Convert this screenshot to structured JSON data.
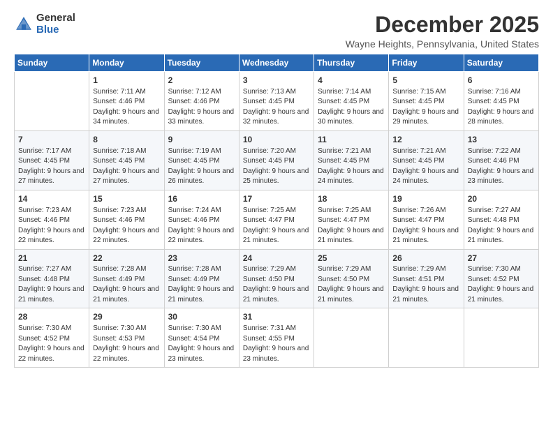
{
  "header": {
    "logo_general": "General",
    "logo_blue": "Blue",
    "month": "December 2025",
    "location": "Wayne Heights, Pennsylvania, United States"
  },
  "days_of_week": [
    "Sunday",
    "Monday",
    "Tuesday",
    "Wednesday",
    "Thursday",
    "Friday",
    "Saturday"
  ],
  "weeks": [
    [
      {
        "day": "",
        "sunrise": "",
        "sunset": "",
        "daylight": ""
      },
      {
        "day": "1",
        "sunrise": "Sunrise: 7:11 AM",
        "sunset": "Sunset: 4:46 PM",
        "daylight": "Daylight: 9 hours and 34 minutes."
      },
      {
        "day": "2",
        "sunrise": "Sunrise: 7:12 AM",
        "sunset": "Sunset: 4:46 PM",
        "daylight": "Daylight: 9 hours and 33 minutes."
      },
      {
        "day": "3",
        "sunrise": "Sunrise: 7:13 AM",
        "sunset": "Sunset: 4:45 PM",
        "daylight": "Daylight: 9 hours and 32 minutes."
      },
      {
        "day": "4",
        "sunrise": "Sunrise: 7:14 AM",
        "sunset": "Sunset: 4:45 PM",
        "daylight": "Daylight: 9 hours and 30 minutes."
      },
      {
        "day": "5",
        "sunrise": "Sunrise: 7:15 AM",
        "sunset": "Sunset: 4:45 PM",
        "daylight": "Daylight: 9 hours and 29 minutes."
      },
      {
        "day": "6",
        "sunrise": "Sunrise: 7:16 AM",
        "sunset": "Sunset: 4:45 PM",
        "daylight": "Daylight: 9 hours and 28 minutes."
      }
    ],
    [
      {
        "day": "7",
        "sunrise": "Sunrise: 7:17 AM",
        "sunset": "Sunset: 4:45 PM",
        "daylight": "Daylight: 9 hours and 27 minutes."
      },
      {
        "day": "8",
        "sunrise": "Sunrise: 7:18 AM",
        "sunset": "Sunset: 4:45 PM",
        "daylight": "Daylight: 9 hours and 27 minutes."
      },
      {
        "day": "9",
        "sunrise": "Sunrise: 7:19 AM",
        "sunset": "Sunset: 4:45 PM",
        "daylight": "Daylight: 9 hours and 26 minutes."
      },
      {
        "day": "10",
        "sunrise": "Sunrise: 7:20 AM",
        "sunset": "Sunset: 4:45 PM",
        "daylight": "Daylight: 9 hours and 25 minutes."
      },
      {
        "day": "11",
        "sunrise": "Sunrise: 7:21 AM",
        "sunset": "Sunset: 4:45 PM",
        "daylight": "Daylight: 9 hours and 24 minutes."
      },
      {
        "day": "12",
        "sunrise": "Sunrise: 7:21 AM",
        "sunset": "Sunset: 4:45 PM",
        "daylight": "Daylight: 9 hours and 24 minutes."
      },
      {
        "day": "13",
        "sunrise": "Sunrise: 7:22 AM",
        "sunset": "Sunset: 4:46 PM",
        "daylight": "Daylight: 9 hours and 23 minutes."
      }
    ],
    [
      {
        "day": "14",
        "sunrise": "Sunrise: 7:23 AM",
        "sunset": "Sunset: 4:46 PM",
        "daylight": "Daylight: 9 hours and 22 minutes."
      },
      {
        "day": "15",
        "sunrise": "Sunrise: 7:23 AM",
        "sunset": "Sunset: 4:46 PM",
        "daylight": "Daylight: 9 hours and 22 minutes."
      },
      {
        "day": "16",
        "sunrise": "Sunrise: 7:24 AM",
        "sunset": "Sunset: 4:46 PM",
        "daylight": "Daylight: 9 hours and 22 minutes."
      },
      {
        "day": "17",
        "sunrise": "Sunrise: 7:25 AM",
        "sunset": "Sunset: 4:47 PM",
        "daylight": "Daylight: 9 hours and 21 minutes."
      },
      {
        "day": "18",
        "sunrise": "Sunrise: 7:25 AM",
        "sunset": "Sunset: 4:47 PM",
        "daylight": "Daylight: 9 hours and 21 minutes."
      },
      {
        "day": "19",
        "sunrise": "Sunrise: 7:26 AM",
        "sunset": "Sunset: 4:47 PM",
        "daylight": "Daylight: 9 hours and 21 minutes."
      },
      {
        "day": "20",
        "sunrise": "Sunrise: 7:27 AM",
        "sunset": "Sunset: 4:48 PM",
        "daylight": "Daylight: 9 hours and 21 minutes."
      }
    ],
    [
      {
        "day": "21",
        "sunrise": "Sunrise: 7:27 AM",
        "sunset": "Sunset: 4:48 PM",
        "daylight": "Daylight: 9 hours and 21 minutes."
      },
      {
        "day": "22",
        "sunrise": "Sunrise: 7:28 AM",
        "sunset": "Sunset: 4:49 PM",
        "daylight": "Daylight: 9 hours and 21 minutes."
      },
      {
        "day": "23",
        "sunrise": "Sunrise: 7:28 AM",
        "sunset": "Sunset: 4:49 PM",
        "daylight": "Daylight: 9 hours and 21 minutes."
      },
      {
        "day": "24",
        "sunrise": "Sunrise: 7:29 AM",
        "sunset": "Sunset: 4:50 PM",
        "daylight": "Daylight: 9 hours and 21 minutes."
      },
      {
        "day": "25",
        "sunrise": "Sunrise: 7:29 AM",
        "sunset": "Sunset: 4:50 PM",
        "daylight": "Daylight: 9 hours and 21 minutes."
      },
      {
        "day": "26",
        "sunrise": "Sunrise: 7:29 AM",
        "sunset": "Sunset: 4:51 PM",
        "daylight": "Daylight: 9 hours and 21 minutes."
      },
      {
        "day": "27",
        "sunrise": "Sunrise: 7:30 AM",
        "sunset": "Sunset: 4:52 PM",
        "daylight": "Daylight: 9 hours and 21 minutes."
      }
    ],
    [
      {
        "day": "28",
        "sunrise": "Sunrise: 7:30 AM",
        "sunset": "Sunset: 4:52 PM",
        "daylight": "Daylight: 9 hours and 22 minutes."
      },
      {
        "day": "29",
        "sunrise": "Sunrise: 7:30 AM",
        "sunset": "Sunset: 4:53 PM",
        "daylight": "Daylight: 9 hours and 22 minutes."
      },
      {
        "day": "30",
        "sunrise": "Sunrise: 7:30 AM",
        "sunset": "Sunset: 4:54 PM",
        "daylight": "Daylight: 9 hours and 23 minutes."
      },
      {
        "day": "31",
        "sunrise": "Sunrise: 7:31 AM",
        "sunset": "Sunset: 4:55 PM",
        "daylight": "Daylight: 9 hours and 23 minutes."
      },
      {
        "day": "",
        "sunrise": "",
        "sunset": "",
        "daylight": ""
      },
      {
        "day": "",
        "sunrise": "",
        "sunset": "",
        "daylight": ""
      },
      {
        "day": "",
        "sunrise": "",
        "sunset": "",
        "daylight": ""
      }
    ]
  ]
}
